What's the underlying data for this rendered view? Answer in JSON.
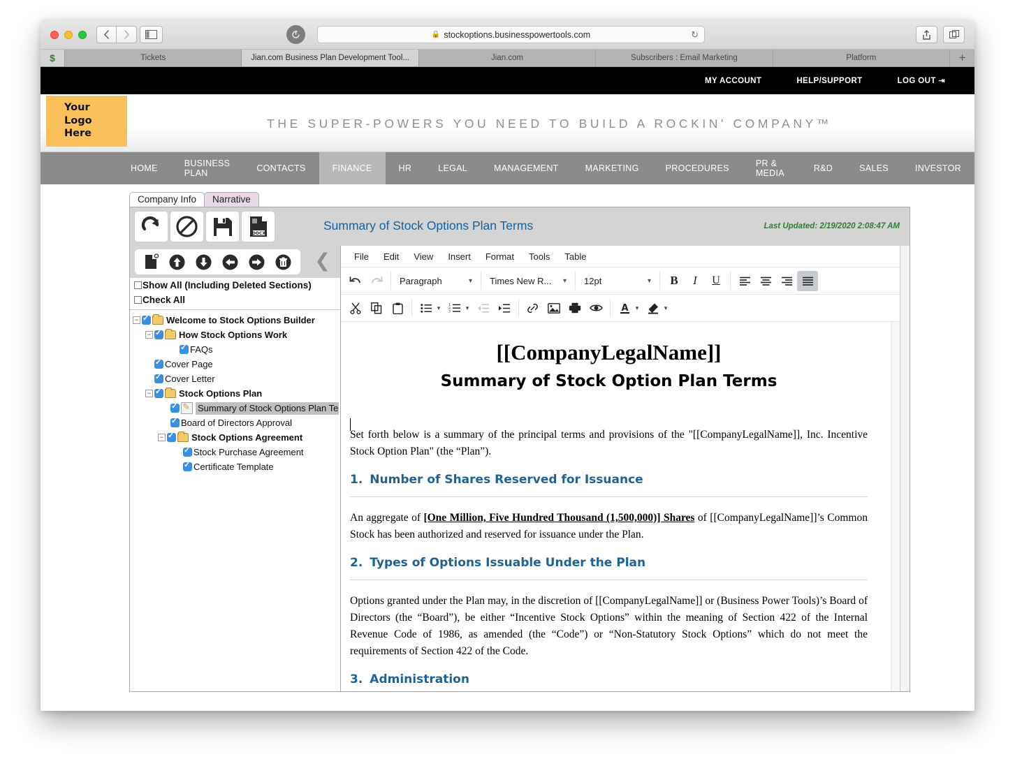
{
  "browser": {
    "url": "stockoptions.businesspowertools.com",
    "lock_icon": "lock-icon",
    "reload_icon": "reload-icon",
    "back_icon": "back-chevron-icon",
    "forward_icon": "forward-chevron-icon",
    "sidebar_icon": "sidebar-toggle-icon",
    "share_icon": "share-icon",
    "newtab_icon": "new-tab-icon",
    "favicon_label": "$",
    "tabs": [
      {
        "label": "Tickets",
        "active": false
      },
      {
        "label": "Jian.com Business Plan Development Tool...",
        "active": true
      },
      {
        "label": "Jian.com",
        "active": false
      },
      {
        "label": "Subscribers : Email Marketing",
        "active": false
      },
      {
        "label": "Platform",
        "active": false
      }
    ],
    "add_tab_label": "+"
  },
  "account_bar": {
    "items": [
      {
        "label": "MY ACCOUNT"
      },
      {
        "label": "HELP/SUPPORT"
      },
      {
        "label": "LOG OUT"
      }
    ],
    "logout_icon": "logout-arrow-icon"
  },
  "header": {
    "logo_lines": [
      "Your",
      "Logo",
      "Here"
    ],
    "logo_bg": "#f9c05c",
    "tagline": "THE SUPER-POWERS YOU NEED TO BUILD A ROCKIN' COMPANY™"
  },
  "mainnav": {
    "active": "FINANCE",
    "items": [
      "HOME",
      "BUSINESS PLAN",
      "CONTACTS",
      "FINANCE",
      "HR",
      "LEGAL",
      "MANAGEMENT",
      "MARKETING",
      "PROCEDURES",
      "PR & MEDIA",
      "R&D",
      "SALES",
      "INVESTOR"
    ]
  },
  "subtabs": [
    {
      "label": "Company Info",
      "active": true
    },
    {
      "label": "Narrative",
      "active": false
    }
  ],
  "panel": {
    "title": "Summary of Stock Options Plan Terms",
    "title_color": "#16609e",
    "last_updated": "Last Updated: 2/19/2020 2:08:47 AM",
    "last_updated_color": "#2e7d32",
    "buttons": [
      {
        "name": "refresh-button",
        "icon": "refresh-arrow-icon"
      },
      {
        "name": "cancel-button",
        "icon": "prohibited-icon"
      },
      {
        "name": "save-button",
        "icon": "floppy-disk-icon"
      },
      {
        "name": "export-docx-button",
        "icon": "docx-file-icon",
        "badge": "DOCX"
      }
    ]
  },
  "tree_toolbar": {
    "buttons": [
      {
        "name": "new-section-button",
        "icon": "new-document-icon"
      },
      {
        "name": "move-up-button",
        "icon": "arrow-up-circle-icon"
      },
      {
        "name": "move-down-button",
        "icon": "arrow-down-circle-icon"
      },
      {
        "name": "outdent-button",
        "icon": "arrow-left-circle-icon"
      },
      {
        "name": "indent-button",
        "icon": "arrow-right-circle-icon"
      },
      {
        "name": "delete-button",
        "icon": "trash-circle-icon"
      }
    ],
    "collapse_icon": "collapse-left-chevron-icon"
  },
  "tree_options": [
    {
      "label": "Show All (Including Deleted Sections)",
      "checked": false
    },
    {
      "label": "Check All",
      "checked": false
    }
  ],
  "tree": [
    {
      "label": "Welcome to Stock Options Builder",
      "depth": 0,
      "type": "folder",
      "expanded": true,
      "checked": true,
      "bold": true,
      "selected": false
    },
    {
      "label": "How Stock Options Work",
      "depth": 1,
      "type": "folder",
      "expanded": true,
      "checked": true,
      "bold": true,
      "selected": false
    },
    {
      "label": "FAQs",
      "depth": 2,
      "type": "leaf",
      "expanded": null,
      "checked": true,
      "bold": false,
      "selected": false
    },
    {
      "label": "Cover Page",
      "depth": 1,
      "type": "leaf",
      "expanded": null,
      "checked": true,
      "bold": false,
      "selected": false
    },
    {
      "label": "Cover Letter",
      "depth": 1,
      "type": "leaf",
      "expanded": null,
      "checked": true,
      "bold": false,
      "selected": false
    },
    {
      "label": "Stock Options Plan",
      "depth": 1,
      "type": "folder",
      "expanded": true,
      "checked": true,
      "bold": true,
      "selected": false
    },
    {
      "label": "Summary of Stock Options Plan Terms",
      "depth": 2,
      "type": "doc",
      "expanded": null,
      "checked": true,
      "bold": false,
      "selected": true
    },
    {
      "label": "Board of Directors Approval",
      "depth": 2,
      "type": "leaf",
      "expanded": null,
      "checked": true,
      "bold": false,
      "selected": false
    },
    {
      "label": "Stock Options Agreement",
      "depth": 2,
      "type": "folder",
      "expanded": true,
      "checked": true,
      "bold": true,
      "selected": false
    },
    {
      "label": "Stock Purchase Agreement",
      "depth": 3,
      "type": "leaf",
      "expanded": null,
      "checked": true,
      "bold": false,
      "selected": false
    },
    {
      "label": "Certificate Template",
      "depth": 3,
      "type": "leaf",
      "expanded": null,
      "checked": true,
      "bold": false,
      "selected": false
    }
  ],
  "editor": {
    "menubar": [
      "File",
      "Edit",
      "View",
      "Insert",
      "Format",
      "Tools",
      "Table"
    ],
    "toolbar_row1": {
      "undo": {
        "label": "undo-icon",
        "enabled": true
      },
      "redo": {
        "label": "redo-icon",
        "enabled": false
      },
      "block_format": "Paragraph",
      "font_family": "Times New R...",
      "font_size": "12pt",
      "bold": "B",
      "italic": "I",
      "underline": "U",
      "align_active": "justify"
    },
    "toolbar_row2_icons": [
      "cut-icon",
      "copy-icon",
      "paste-icon",
      "bullet-list-icon",
      "numbered-list-icon",
      "outdent-icon",
      "indent-icon",
      "link-icon",
      "image-icon",
      "print-icon",
      "preview-eye-icon",
      "text-color-icon",
      "highlight-color-icon"
    ]
  },
  "document": {
    "title": "[[CompanyLegalName]]",
    "subtitle": "Summary of Stock Option Plan Terms",
    "intro": "Set forth below is a summary of the principal terms and provisions of the \"[[CompanyLegalName]], Inc. Incentive Stock Option Plan\" (the “Plan”).",
    "sections": [
      {
        "num": "1.",
        "heading": "Number of Shares Reserved for Issuance",
        "body_pre": "An aggregate of ",
        "body_underline": "[One Million, Five Hundred Thousand (1,500,000)] Shares",
        "body_post": " of [[CompanyLegalName]]’s Common Stock has been authorized and reserved for issuance under the Plan."
      },
      {
        "num": "2.",
        "heading": "Types of Options Issuable Under the Plan",
        "body_pre": "Options granted under the Plan may, in the discretion of [[CompanyLegalName]] or (Business Power Tools)’s Board of Directors (the “Board”), be either “Incentive Stock Options” within the meaning of Section 422 of the Internal Revenue Code of 1986, as amended (the “Code”) or “Non-Statutory Stock Options” which do not meet the requirements of Section 422 of the Code.",
        "body_underline": "",
        "body_post": ""
      },
      {
        "num": "3.",
        "heading": "Administration",
        "body_pre": "",
        "body_underline": "",
        "body_post": ""
      }
    ]
  }
}
